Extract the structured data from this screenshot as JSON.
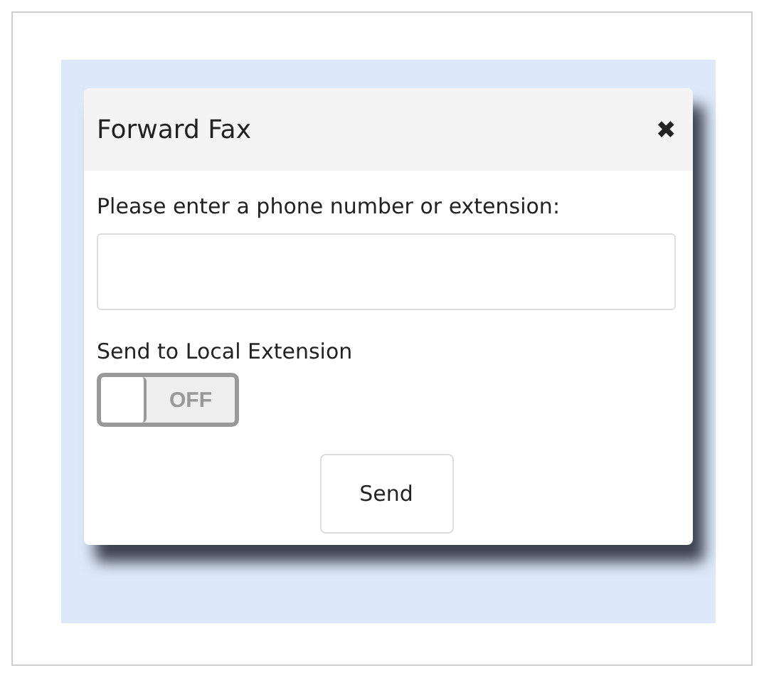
{
  "dialog": {
    "title": "Forward Fax",
    "close": "✖",
    "prompt": "Please enter a phone number or extension:",
    "toggle_label": "Send to Local Extension",
    "toggle": {
      "on": false,
      "label": "OFF"
    },
    "buttons": [
      "Send"
    ]
  }
}
